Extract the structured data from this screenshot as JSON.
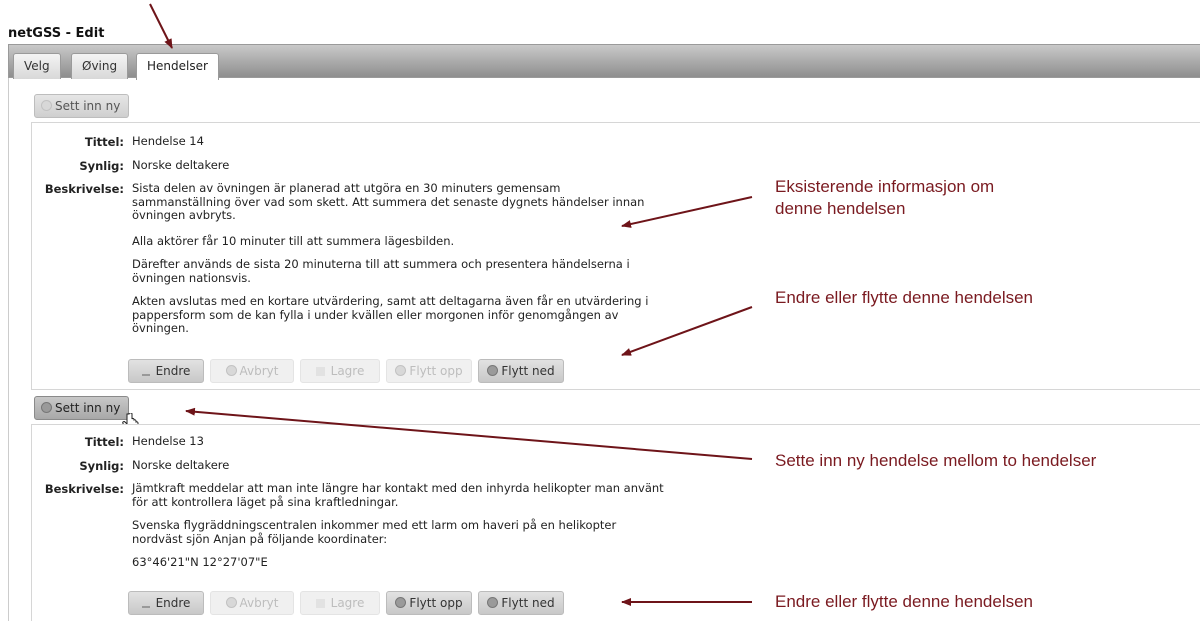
{
  "app": {
    "title": "netGSS - Edit"
  },
  "tabs": [
    {
      "label": "Velg"
    },
    {
      "label": "Øving"
    },
    {
      "label": "Hendelser"
    }
  ],
  "insert_label": "Sett inn ny",
  "field_labels": {
    "title": "Tittel:",
    "visible": "Synlig:",
    "description": "Beskrivelse:"
  },
  "actions": {
    "edit": "Endre",
    "cancel": "Avbryt",
    "save": "Lagre",
    "move_up": "Flytt opp",
    "move_down": "Flytt ned"
  },
  "events": [
    {
      "title": "Hendelse 14",
      "visible": "Norske deltakere",
      "description": [
        "Sista delen av övningen är planerad att utgöra en 30 minuters gemensam sammanställning över vad som skett. Att summera det senaste dygnets händelser innan övningen avbryts.",
        "Alla aktörer får 10 minuter till att summera lägesbilden.",
        "Därefter används de sista 20 minuterna till att summera och presentera händelserna i övningen nationsvis.",
        "Akten avslutas med en kortare utvärdering, samt att deltagarna även får en utvärdering i pappersform som de kan fylla i under kvällen eller morgonen inför genomgången av övningen."
      ]
    },
    {
      "title": "Hendelse 13",
      "visible": "Norske deltakere",
      "description": [
        "Jämtkraft meddelar att man inte längre har kontakt med den inhyrda helikopter man använt för att kontrollera läget på sina kraftledningar.",
        "Svenska flygräddningscentralen inkommer med ett larm om haveri på en helikopter nordväst sjön Anjan på följande koordinater:",
        "63°46'21\"N 12°27'07\"E"
      ]
    }
  ],
  "annotations": {
    "existing_info": [
      "Eksisterende informasjon om",
      "denne hendelsen"
    ],
    "edit_move_1": "Endre eller flytte denne hendelsen",
    "insert_between": "Sette inn ny hendelse mellom to hendelser",
    "edit_move_2": "Endre eller flytte denne hendelsen"
  },
  "colors": {
    "annotation": "#7a1a20"
  }
}
